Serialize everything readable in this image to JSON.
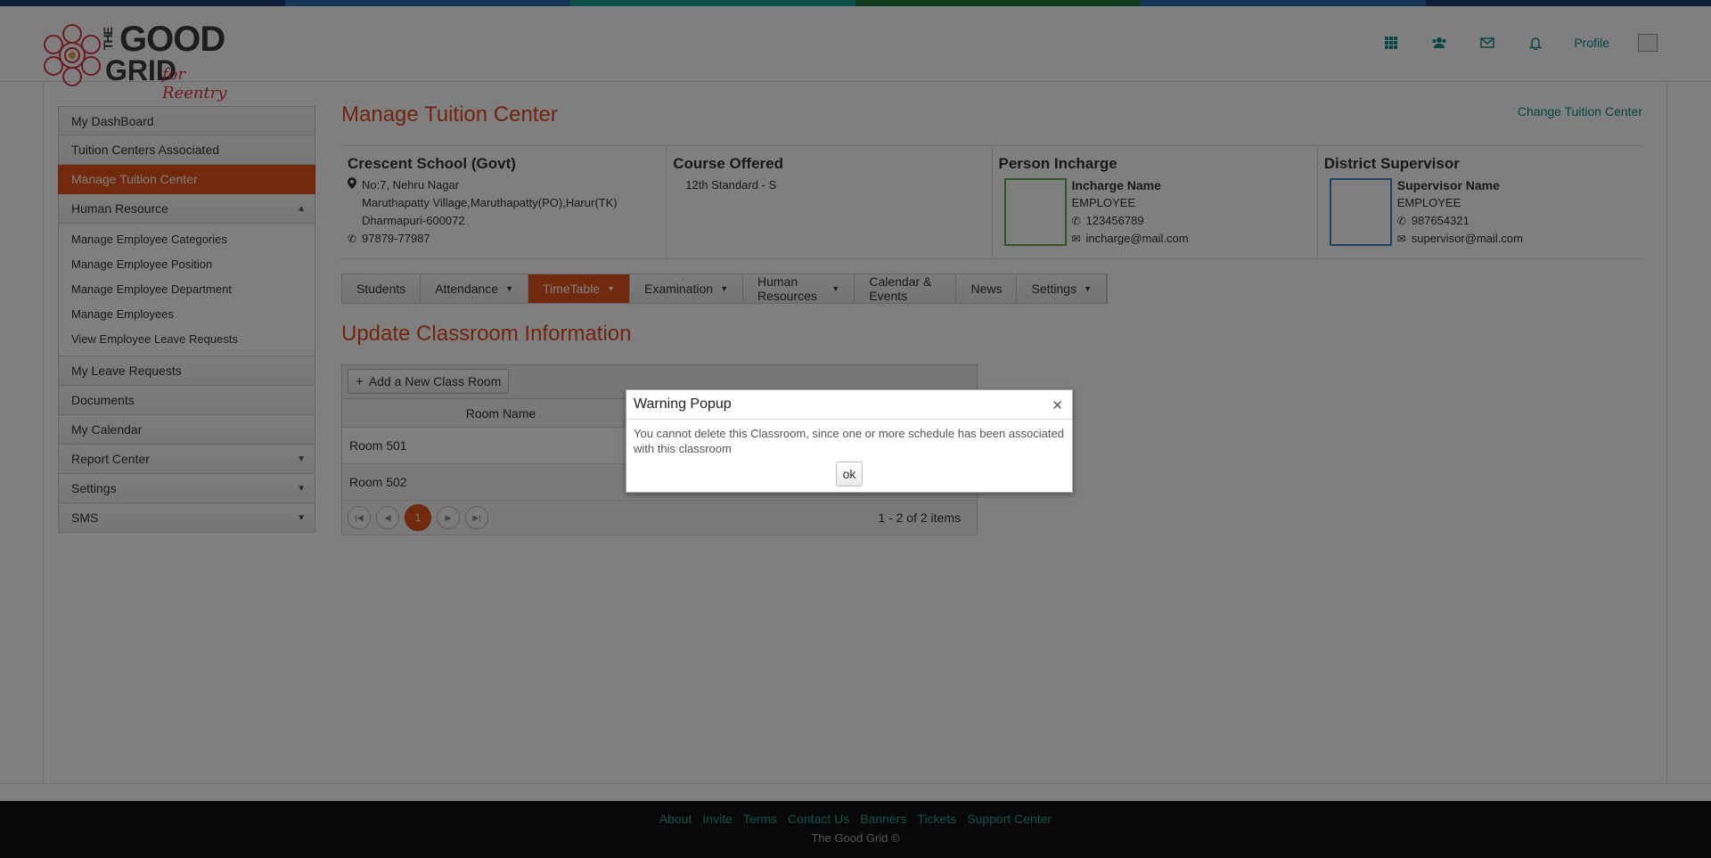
{
  "brand": {
    "logo_the": "THE",
    "logo_good": "GOOD",
    "logo_grid": "GRID",
    "logo_sub": "for Reentry",
    "strip_colors": [
      "#1b3a6b",
      "#2a6fb0",
      "#1a9c8e",
      "#1e7a3c",
      "#2a6fb0",
      "#1b3a6b"
    ]
  },
  "topnav": {
    "icons": [
      "grid-icon",
      "users-icon",
      "mail-icon",
      "bell-icon"
    ],
    "profile_label": "Profile"
  },
  "sidebar": {
    "items": [
      {
        "label": "My DashBoard"
      },
      {
        "label": "Tuition Centers Associated"
      },
      {
        "label": "Manage Tuition Center"
      },
      {
        "label": "Human Resource"
      }
    ],
    "hr_sub": [
      {
        "label": "Manage Employee Categories"
      },
      {
        "label": "Manage Employee Position"
      },
      {
        "label": "Manage Employee Department"
      },
      {
        "label": "Manage Employees"
      },
      {
        "label": "View Employee Leave Requests"
      }
    ],
    "items_after": [
      {
        "label": "My Leave Requests"
      },
      {
        "label": "Documents"
      },
      {
        "label": "My Calendar"
      },
      {
        "label": "Report Center"
      },
      {
        "label": "Settings"
      },
      {
        "label": "SMS"
      }
    ]
  },
  "main": {
    "title": "Manage Tuition Center",
    "change_link": "Change Tuition Center",
    "school": {
      "name": "Crescent School (Govt)",
      "address1": "No:7, Nehru Nagar",
      "address2": "Maruthapatty Village,Maruthapatty(PO),Harur(TK)",
      "address3": "Dharmapuri-600072",
      "phone": "97879-77987"
    },
    "course": {
      "heading": "Course Offered",
      "value": "12th Standard - S"
    },
    "incharge": {
      "heading": "Person Incharge",
      "name": "Incharge Name",
      "role": "EMPLOYEE",
      "phone": "123456789",
      "email": "incharge@mail.com",
      "photo_border": "#6aa84f"
    },
    "supervisor": {
      "heading": "District Supervisor",
      "name": "Supervisor Name",
      "role": "EMPLOYEE",
      "phone": "987654321",
      "email": "supervisor@mail.com",
      "photo_border": "#3d85c6"
    },
    "tabs": [
      {
        "label": "Students"
      },
      {
        "label": "Attendance"
      },
      {
        "label": "TimeTable"
      },
      {
        "label": "Examination"
      },
      {
        "label": "Human Resources"
      },
      {
        "label": "Calendar & Events"
      },
      {
        "label": "News"
      },
      {
        "label": "Settings"
      }
    ],
    "section_title": "Update Classroom Information",
    "grid": {
      "add_label": "Add a New Class Room",
      "col_room": "Room Name",
      "rows": [
        "Room 501",
        "Room 502"
      ],
      "current_page": "1",
      "pager_info": "1 - 2 of 2 items"
    }
  },
  "footer": {
    "links": [
      "About",
      "Invite",
      "Terms",
      "Contact Us",
      "Banners",
      "Tickets",
      "Support Center"
    ],
    "copyright": "The Good Grid ©"
  },
  "modal": {
    "title": "Warning Popup",
    "message": "You cannot delete this Classroom, since one or more schedule has been associated with this classroom",
    "ok_label": "ok"
  },
  "colors": {
    "accent": "#e2551c",
    "link": "#0b8c8c"
  }
}
